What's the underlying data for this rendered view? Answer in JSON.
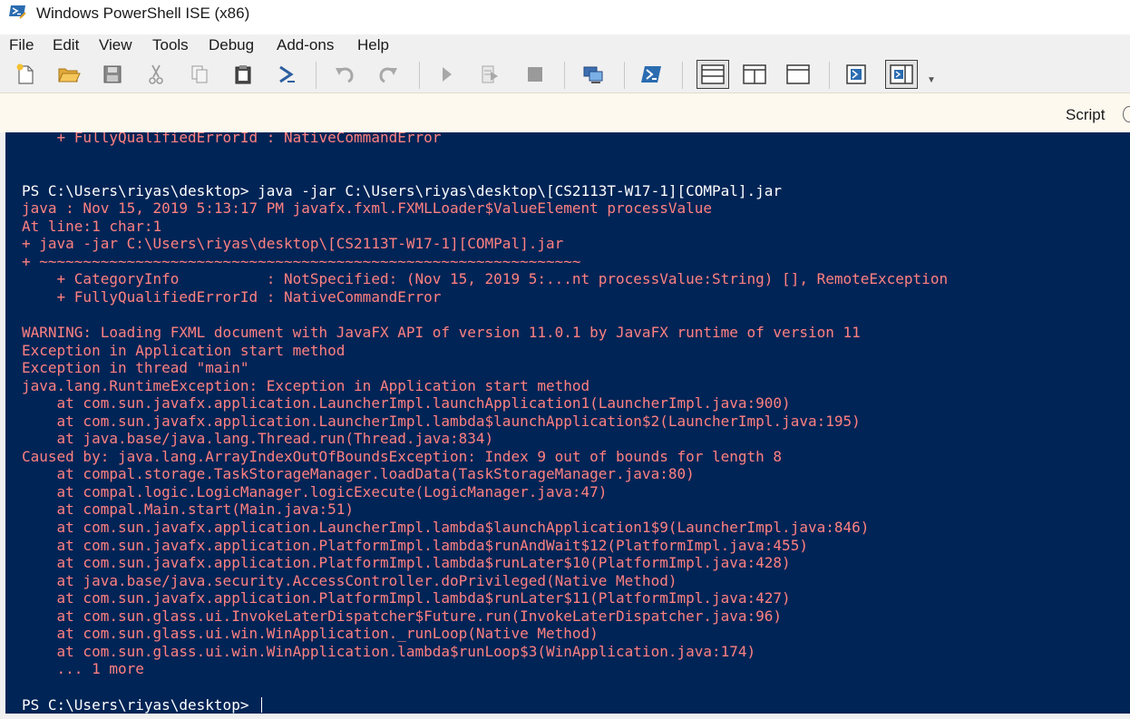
{
  "window": {
    "title": "Windows PowerShell ISE (x86)"
  },
  "menu": {
    "items": [
      "File",
      "Edit",
      "View",
      "Tools",
      "Debug",
      "Add-ons",
      "Help"
    ]
  },
  "toolbar": {
    "icons": [
      "new-script-icon",
      "open-icon",
      "save-icon",
      "cut-icon",
      "copy-icon",
      "paste-icon",
      "run-powershell-icon",
      "undo-icon",
      "redo-icon",
      "run-script-icon",
      "run-selection-icon",
      "stop-icon",
      "new-remote-tab-icon",
      "start-powershell-exe-icon",
      "show-script-top-icon",
      "show-script-right-icon",
      "show-script-maximized-icon",
      "show-command-window-icon",
      "show-command-addon-icon",
      "toolbar-overflow-icon"
    ]
  },
  "script_pane": {
    "label": "Script"
  },
  "console": {
    "lines": [
      {
        "text": "    + FullyQualifiedErrorId : NativeCommandError",
        "kind": "err"
      },
      {
        "text": "",
        "kind": "err"
      },
      {
        "text": "",
        "kind": "err"
      },
      {
        "text": "PS C:\\Users\\riyas\\desktop> java -jar C:\\Users\\riyas\\desktop\\[CS2113T-W17-1][COMPal].jar",
        "kind": "cmd"
      },
      {
        "text": "java : Nov 15, 2019 5:13:17 PM javafx.fxml.FXMLLoader$ValueElement processValue",
        "kind": "err"
      },
      {
        "text": "At line:1 char:1",
        "kind": "err"
      },
      {
        "text": "+ java -jar C:\\Users\\riyas\\desktop\\[CS2113T-W17-1][COMPal].jar",
        "kind": "err"
      },
      {
        "text": "+ ~~~~~~~~~~~~~~~~~~~~~~~~~~~~~~~~~~~~~~~~~~~~~~~~~~~~~~~~~~~~~~",
        "kind": "err"
      },
      {
        "text": "    + CategoryInfo          : NotSpecified: (Nov 15, 2019 5:...nt processValue:String) [], RemoteException",
        "kind": "err"
      },
      {
        "text": "    + FullyQualifiedErrorId : NativeCommandError",
        "kind": "err"
      },
      {
        "text": "",
        "kind": "err"
      },
      {
        "text": "WARNING: Loading FXML document with JavaFX API of version 11.0.1 by JavaFX runtime of version 11",
        "kind": "err"
      },
      {
        "text": "Exception in Application start method",
        "kind": "err"
      },
      {
        "text": "Exception in thread \"main\"",
        "kind": "err"
      },
      {
        "text": "java.lang.RuntimeException: Exception in Application start method",
        "kind": "err"
      },
      {
        "text": "    at com.sun.javafx.application.LauncherImpl.launchApplication1(LauncherImpl.java:900)",
        "kind": "err"
      },
      {
        "text": "    at com.sun.javafx.application.LauncherImpl.lambda$launchApplication$2(LauncherImpl.java:195)",
        "kind": "err"
      },
      {
        "text": "    at java.base/java.lang.Thread.run(Thread.java:834)",
        "kind": "err"
      },
      {
        "text": "Caused by: java.lang.ArrayIndexOutOfBoundsException: Index 9 out of bounds for length 8",
        "kind": "err"
      },
      {
        "text": "    at compal.storage.TaskStorageManager.loadData(TaskStorageManager.java:80)",
        "kind": "err"
      },
      {
        "text": "    at compal.logic.LogicManager.logicExecute(LogicManager.java:47)",
        "kind": "err"
      },
      {
        "text": "    at compal.Main.start(Main.java:51)",
        "kind": "err"
      },
      {
        "text": "    at com.sun.javafx.application.LauncherImpl.lambda$launchApplication1$9(LauncherImpl.java:846)",
        "kind": "err"
      },
      {
        "text": "    at com.sun.javafx.application.PlatformImpl.lambda$runAndWait$12(PlatformImpl.java:455)",
        "kind": "err"
      },
      {
        "text": "    at com.sun.javafx.application.PlatformImpl.lambda$runLater$10(PlatformImpl.java:428)",
        "kind": "err"
      },
      {
        "text": "    at java.base/java.security.AccessController.doPrivileged(Native Method)",
        "kind": "err"
      },
      {
        "text": "    at com.sun.javafx.application.PlatformImpl.lambda$runLater$11(PlatformImpl.java:427)",
        "kind": "err"
      },
      {
        "text": "    at com.sun.glass.ui.InvokeLaterDispatcher$Future.run(InvokeLaterDispatcher.java:96)",
        "kind": "err"
      },
      {
        "text": "    at com.sun.glass.ui.win.WinApplication._runLoop(Native Method)",
        "kind": "err"
      },
      {
        "text": "    at com.sun.glass.ui.win.WinApplication.lambda$runLoop$3(WinApplication.java:174)",
        "kind": "err"
      },
      {
        "text": "    ... 1 more",
        "kind": "err"
      },
      {
        "text": "",
        "kind": "err"
      },
      {
        "text": "PS C:\\Users\\riyas\\desktop> ",
        "kind": "prompt"
      }
    ]
  },
  "colors": {
    "console_background": "#012456",
    "error_text": "#ff8080",
    "command_text": "#ffffff"
  }
}
